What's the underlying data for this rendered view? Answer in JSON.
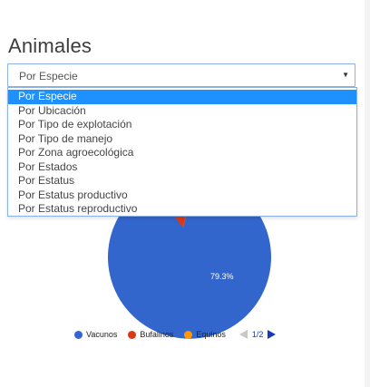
{
  "page": {
    "title": "Animales"
  },
  "select": {
    "value": "Por Especie",
    "options": [
      "Por Especie",
      "Por Ubicación",
      "Por Tipo de explotación",
      "Por Tipo de manejo",
      "Por Zona agroecológica",
      "Por Estados",
      "Por Estatus",
      "Por Estatus productivo",
      "Por Estatus reproductivo"
    ],
    "selected_index": 0
  },
  "chart_data": {
    "type": "pie",
    "series": [
      {
        "name": "Vacunos",
        "value": 79.3,
        "color": "#3366cc"
      },
      {
        "name": "Bufalinos",
        "color": "#dc3912"
      },
      {
        "name": "Equinos",
        "color": "#ff9900"
      }
    ],
    "slice_labels": [
      "79.3%"
    ],
    "legend_position": "bottom"
  },
  "legend": {
    "items": [
      {
        "label": "Vacunos",
        "color": "#3366cc"
      },
      {
        "label": "Bufalinos",
        "color": "#dc3912"
      },
      {
        "label": "Equinos",
        "color": "#ff9900"
      }
    ],
    "page_indicator": "1/2"
  },
  "icons": {
    "select_arrow": "chevron-down-icon",
    "pager_prev": "triangle-left-icon",
    "pager_next": "triangle-right-icon"
  }
}
